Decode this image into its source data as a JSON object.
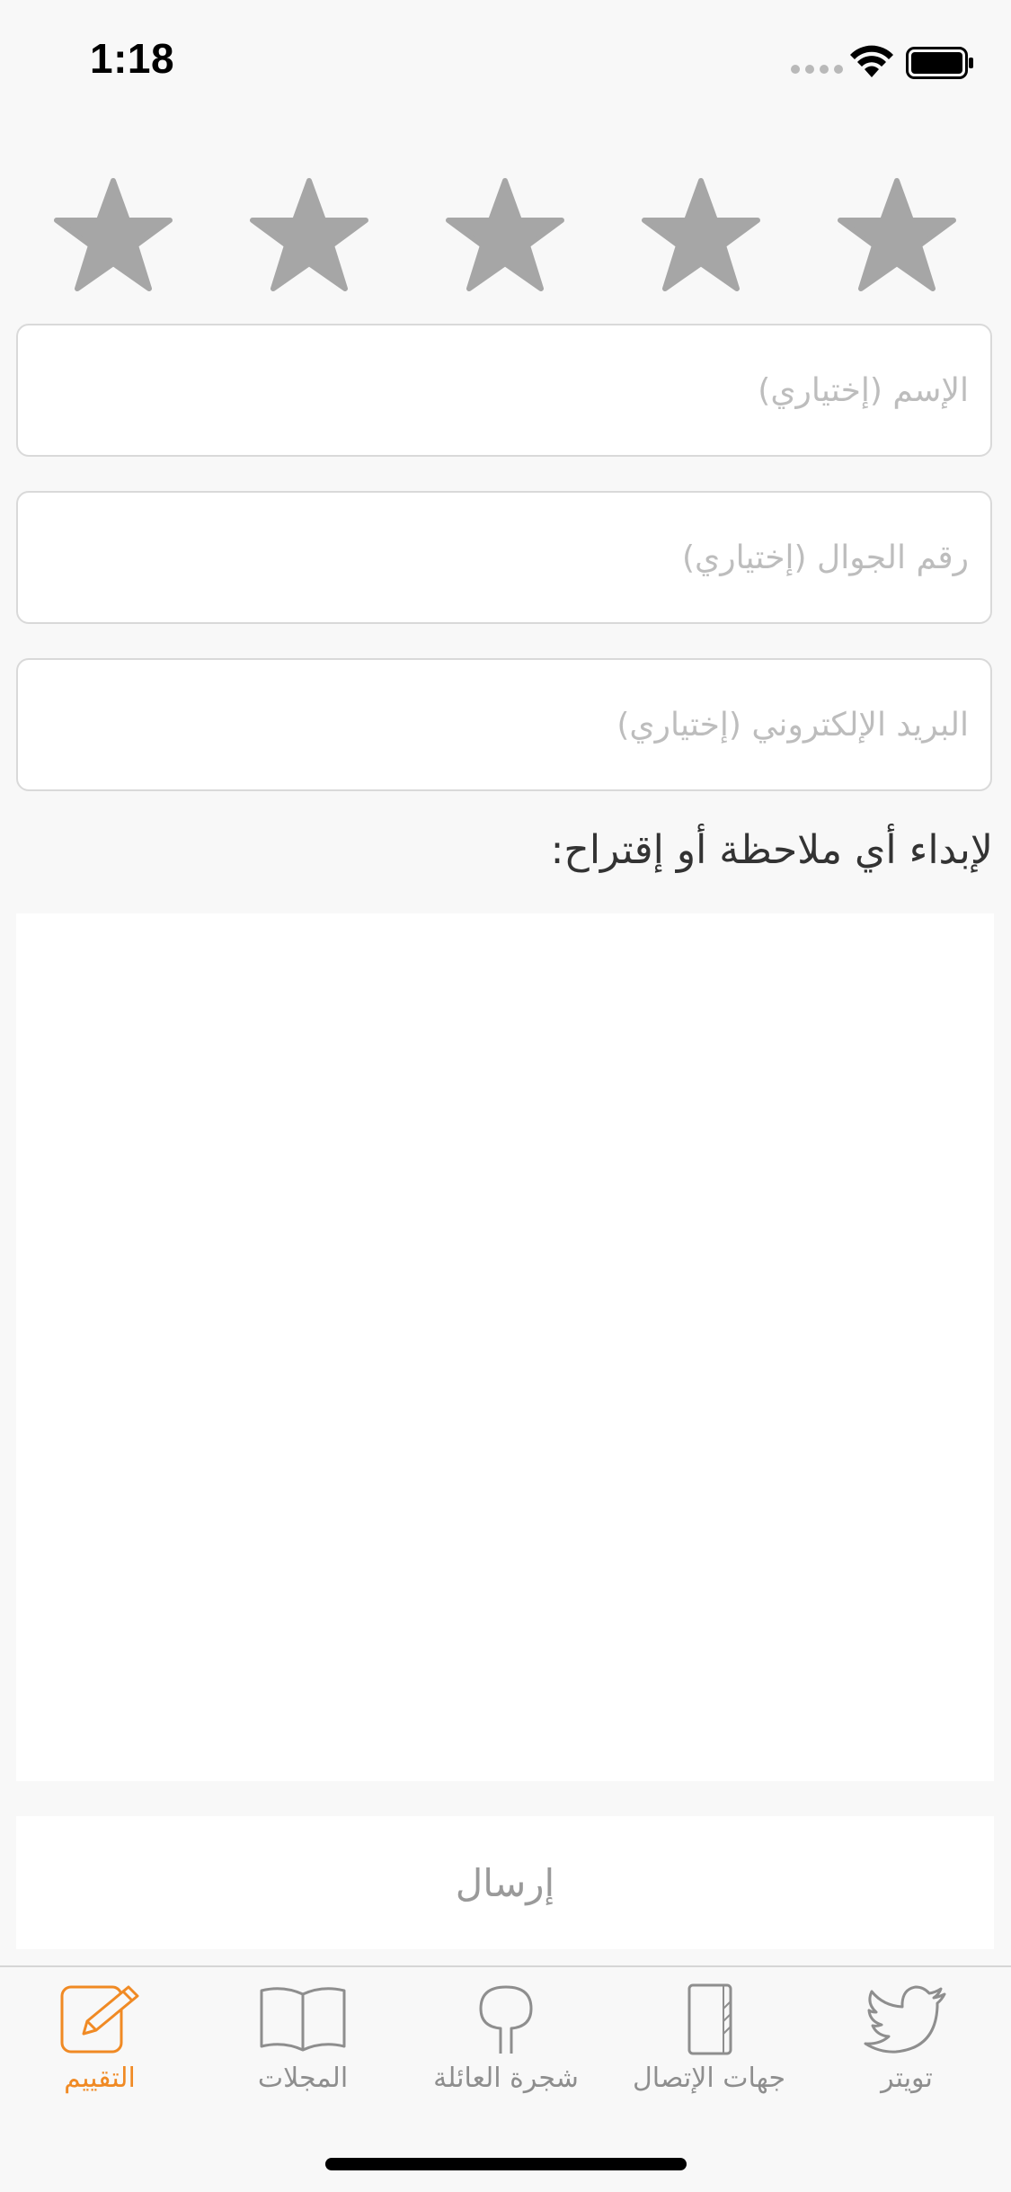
{
  "status_bar": {
    "time": "1:18"
  },
  "rating": {
    "stars_total": 5,
    "stars_selected": 0,
    "star_color": "#a6a6a6"
  },
  "form": {
    "name_placeholder": "الإسم (إختياري)",
    "name_value": "",
    "phone_placeholder": "رقم الجوال (إختياري)",
    "phone_value": "",
    "email_placeholder": "البريد الإلكتروني (إختياري)",
    "email_value": "",
    "notes_label": "لإبداء أي ملاحظة أو إقتراح:",
    "notes_value": "",
    "send_label": "إرسال"
  },
  "tabs": [
    {
      "label": "التقييم",
      "icon": "edit-icon",
      "active": true
    },
    {
      "label": "المجلات",
      "icon": "book-icon",
      "active": false
    },
    {
      "label": "شجرة العائلة",
      "icon": "tree-icon",
      "active": false
    },
    {
      "label": "جهات الإتصال",
      "icon": "contacts-book-icon",
      "active": false
    },
    {
      "label": "تويتر",
      "icon": "twitter-icon",
      "active": false
    }
  ],
  "colors": {
    "accent": "#f08a24",
    "inactive": "#8e8e8e",
    "background": "#f8f8f8"
  }
}
